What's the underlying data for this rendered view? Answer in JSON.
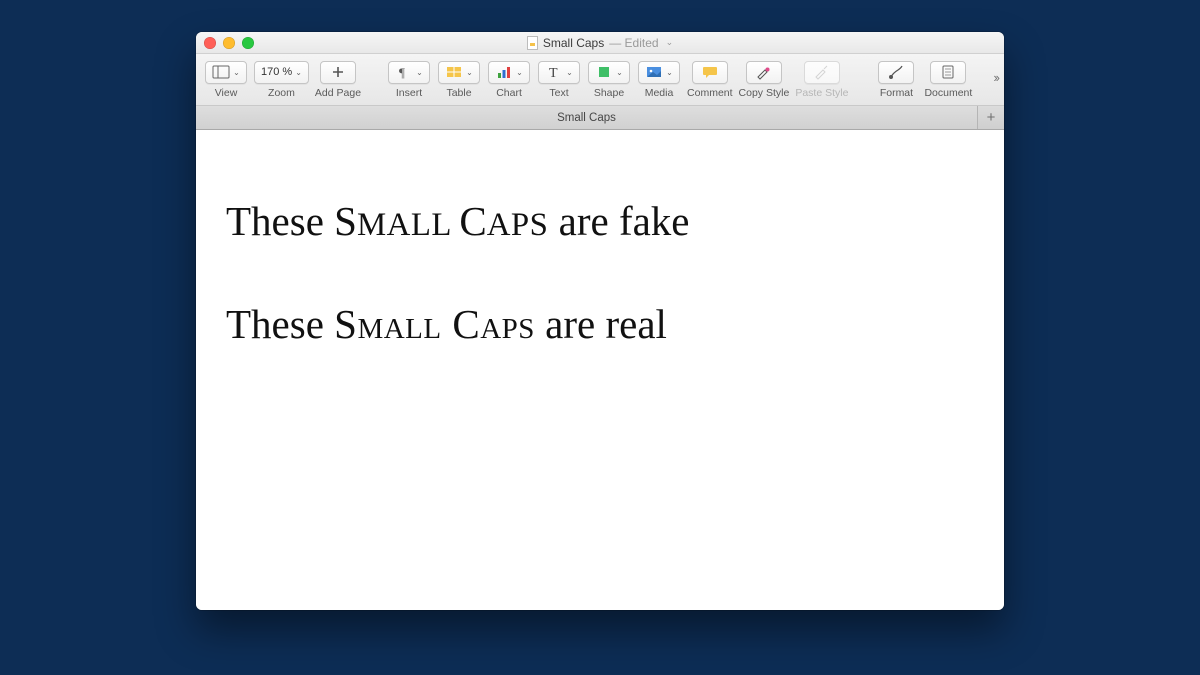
{
  "window": {
    "doc_name": "Small Caps",
    "edited_suffix": "— Edited"
  },
  "toolbar": {
    "view": "View",
    "zoom": "Zoom",
    "zoom_value": "170 %",
    "add_page": "Add Page",
    "insert": "Insert",
    "table": "Table",
    "chart": "Chart",
    "text": "Text",
    "shape": "Shape",
    "media": "Media",
    "comment": "Comment",
    "copy_style": "Copy Style",
    "paste_style": "Paste Style",
    "format": "Format",
    "document": "Document"
  },
  "tabs": {
    "tab0": "Small Caps",
    "new_tab_glyph": "+"
  },
  "document": {
    "line1": {
      "prefix": "These ",
      "sc_1": "S",
      "sc_1r": "MALL ",
      "sc_2": "C",
      "sc_2r": "APS",
      "suffix": " are fake"
    },
    "line2": {
      "prefix": "These ",
      "sc": "Small Caps",
      "suffix": " are real"
    }
  },
  "glyphs": {
    "overflow": "››",
    "title_chevron": "⌄",
    "dropdown_chevron": "⌄"
  }
}
